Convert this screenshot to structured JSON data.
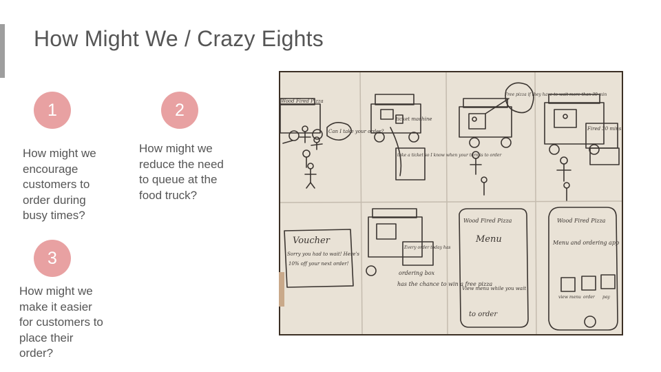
{
  "slide": {
    "title": "How Might We / Crazy Eights"
  },
  "questions": [
    {
      "number": "1",
      "text": "How might we encourage customers to order during busy times?"
    },
    {
      "number": "2",
      "text": "How might we reduce the need to queue at the food truck?"
    },
    {
      "number": "3",
      "text": "How might we make it easier for customers to place their order?"
    }
  ],
  "sketch_photo": {
    "panels": [
      {
        "texts": [
          "Wood Fired Pizza",
          "Can I take your order?"
        ]
      },
      {
        "texts": [
          "ticket machine",
          "take a ticket so I know when your turn is to order"
        ]
      },
      {
        "texts": [
          "Free pizza if they have to wait more than 30 min"
        ]
      },
      {
        "texts": [
          "Fired 30 mins"
        ]
      },
      {
        "texts": [
          "Voucher",
          "Sorry you had to wait! Here's",
          "10% off your next order!"
        ]
      },
      {
        "texts": [
          "Every order today has",
          "ordering box",
          "has the chance to win a free pizza"
        ]
      },
      {
        "texts": [
          "Wood Fired Pizza",
          "Menu",
          "View menu while you wait",
          "to order"
        ]
      },
      {
        "texts": [
          "Wood Fired Pizza",
          "Menu and ordering app",
          "view menu",
          "order",
          "pay"
        ]
      }
    ],
    "colors": {
      "paper": "#e9e2d6",
      "ink": "#3a3430",
      "background": "#3b2f24"
    }
  },
  "colors": {
    "circle": "#e8a1a2",
    "text": "#555555",
    "accent_bar": "#9e9e9e"
  }
}
